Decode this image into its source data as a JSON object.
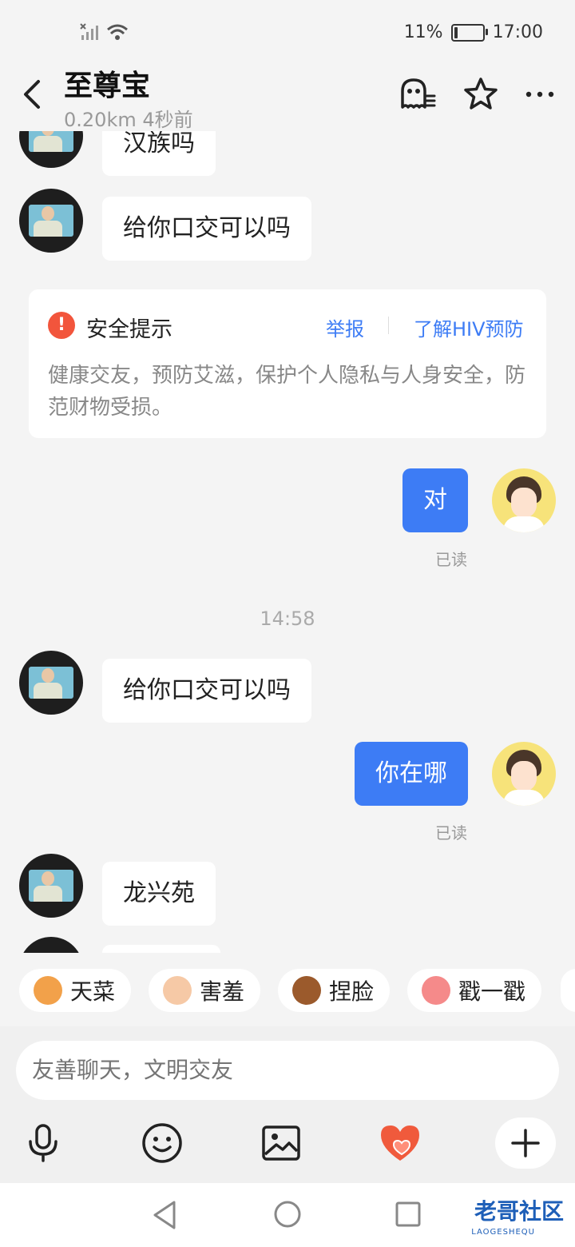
{
  "status_bar": {
    "battery": "11%",
    "time": "17:00",
    "battery_level": 0.11
  },
  "header": {
    "title": "至尊宝",
    "subtitle": "0.20km 4秒前"
  },
  "messages": [
    {
      "text": "汉族吗"
    },
    {
      "text": "给你口交可以吗"
    },
    {
      "text": "对",
      "read": "已读"
    },
    {
      "text": "给你口交可以吗"
    },
    {
      "text": "你在哪",
      "read": "已读"
    },
    {
      "text": "龙兴苑"
    }
  ],
  "timestamp": "14:58",
  "safety": {
    "title": "安全提示",
    "icon": "!",
    "report": "举报",
    "learn": "了解HIV预防",
    "body": "健康交友，预防艾滋，保护个人隐私与人身安全，防范财物受损。"
  },
  "chips": [
    "天菜",
    "害羞",
    "捏脸",
    "戳一戳"
  ],
  "input": {
    "placeholder": "友善聊天，文明交友"
  },
  "watermark": {
    "main": "老哥社区",
    "sub": "LAOGESHEQU"
  },
  "colors": {
    "accent": "#3d7cf5",
    "warning": "#f2553c",
    "heart": "#f05a3c"
  }
}
